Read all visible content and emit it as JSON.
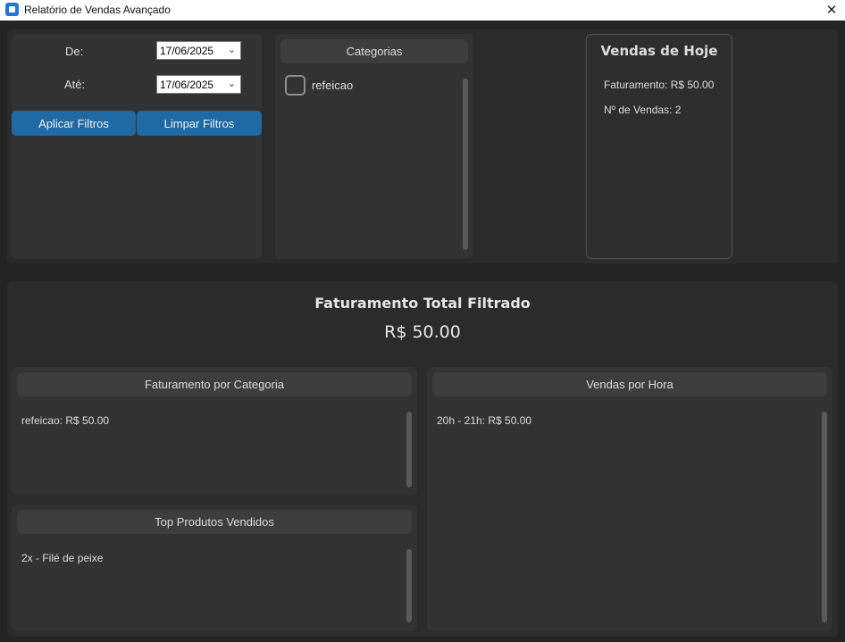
{
  "window": {
    "title": "Relatório de Vendas Avançado",
    "close_symbol": "✕"
  },
  "filters": {
    "from_label": "De:",
    "from_value": "17/06/2025",
    "to_label": "Até:",
    "to_value": "17/06/2025",
    "apply_label": "Aplicar Filtros",
    "clear_label": "Limpar Filtros"
  },
  "categories": {
    "header": "Categorias",
    "items": [
      {
        "label": "refeicao",
        "checked": false
      }
    ]
  },
  "today": {
    "title": "Vendas de Hoje",
    "revenue": "Faturamento: R$ 50.00",
    "count": "Nº de Vendas: 2"
  },
  "total": {
    "title": "Faturamento Total Filtrado",
    "value": "R$ 50.00"
  },
  "by_category": {
    "header": "Faturamento por Categoria",
    "rows": [
      "refeicao: R$ 50.00"
    ]
  },
  "by_hour": {
    "header": "Vendas por Hora",
    "rows": [
      "20h - 21h: R$ 50.00"
    ]
  },
  "top_products": {
    "header": "Top Produtos Vendidos",
    "rows": [
      "2x - Filé de peixe"
    ]
  },
  "colors": {
    "accent": "#1f6aa5",
    "background": "#242424",
    "panel": "#2b2b2b"
  }
}
